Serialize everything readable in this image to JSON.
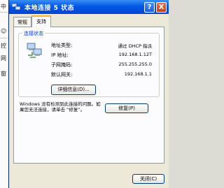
{
  "background": {
    "glyphs": [
      "中",
      "☺",
      "控",
      "网",
      "窗"
    ]
  },
  "window": {
    "title": "本地连接 5 状态",
    "help_button": "?",
    "close_button": "X"
  },
  "tabs": [
    {
      "label": "常规",
      "active": false
    },
    {
      "label": "支持",
      "active": true
    }
  ],
  "connection_status": {
    "group_label": "连接状态",
    "rows": [
      {
        "label": "地址类型:",
        "value": "通过 DHCP 指派"
      },
      {
        "label": "IP 地址:",
        "value": "192.168.1.12T"
      },
      {
        "label": "子网掩码:",
        "value": "255.255.255.0"
      },
      {
        "label": "默认网关:",
        "value": "192.168.1.1"
      }
    ],
    "details_button": "详细信息(D)..."
  },
  "repair_section": {
    "text": "Windows 没有检测到此连接的问题。如果您无法连接，请单击 “修复”。",
    "repair_button": "修复(P)"
  },
  "footer": {
    "close_button": "关闭(C)"
  },
  "colors": {
    "titlebar": "#0058e6",
    "group_label": "#0046d5",
    "tab_highlight": "#f7b52e"
  }
}
